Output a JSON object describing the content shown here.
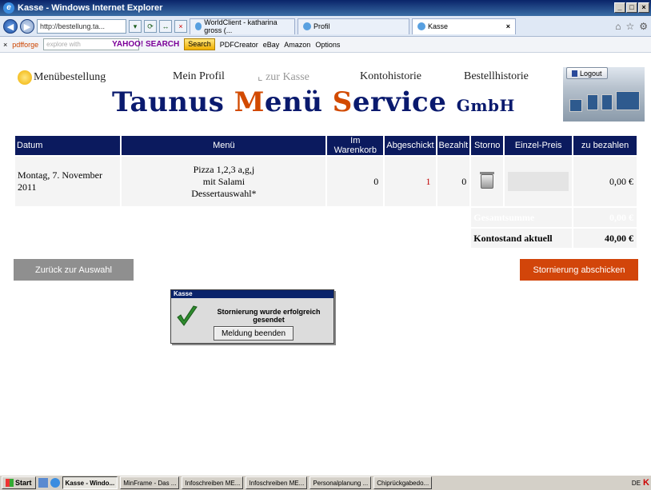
{
  "window": {
    "title": "Kasse - Windows Internet Explorer"
  },
  "browser": {
    "address": "http://bestellung.ta...",
    "tabs": [
      {
        "label": "WorldClient - katharina gross (..."
      },
      {
        "label": "Profil"
      },
      {
        "label": "Kasse"
      }
    ],
    "toolbar": {
      "brand": "pdfforge",
      "search_placeholder": "explore with",
      "search_brand": "YAHOO! SEARCH",
      "search_button": "Search",
      "links": [
        "PDFCreator",
        "eBay",
        "Amazon",
        "Options"
      ]
    }
  },
  "nav": {
    "menuebestellung": "Menübestellung",
    "profil": "Mein Profil",
    "kasse": "zur Kasse",
    "kontohistorie": "Kontohistorie",
    "bestellhistorie": "Bestellhistorie",
    "logout": "Logout"
  },
  "logo": {
    "part1": "T",
    "part2": "aunus ",
    "part3": "M",
    "part4": "enü ",
    "part5": "S",
    "part6": "ervice ",
    "part7": "GmbH"
  },
  "table": {
    "headers": [
      "Datum",
      "Menü",
      "Im Warenkorb",
      "Abgeschickt",
      "Bezahlt",
      "Storno",
      "Einzel-Preis",
      "zu bezahlen"
    ],
    "row": {
      "datum": "Montag, 7. November 2011",
      "menu_line1": "Pizza 1,2,3 a,g,j",
      "menu_line2": "mit Salami",
      "menu_line3": "Dessertauswahl*",
      "warenkorb": "0",
      "abgeschickt": "1",
      "bezahlt": "0",
      "zu_bezahlen": "0,00 €"
    },
    "summe_label": "Gesamtsumme",
    "summe_value": "0,00 €",
    "kontostand_label": "Kontostand aktuell",
    "kontostand_value": "40,00 €"
  },
  "buttons": {
    "back": "Zurück zur Auswahl",
    "storno": "Stornierung abschicken"
  },
  "dialog": {
    "title": "Kasse",
    "message_line1": "Stornierung wurde erfolgreich",
    "message_line2": "gesendet",
    "button": "Meldung beenden"
  },
  "taskbar": {
    "start": "Start",
    "tasks": [
      "Kasse - Windo...",
      "MinFrame - Das ...",
      "Infoschreiben ME...",
      "Infoschreiben ME...",
      "Personalplanung ...",
      "Chiprückgabedo..."
    ],
    "lang": "DE"
  },
  "colors": {
    "header_blue": "#0b1a5e",
    "storno_orange": "#d2450a",
    "back_gray": "#8f8f8f",
    "abgeschickt_red": "#c00000"
  }
}
